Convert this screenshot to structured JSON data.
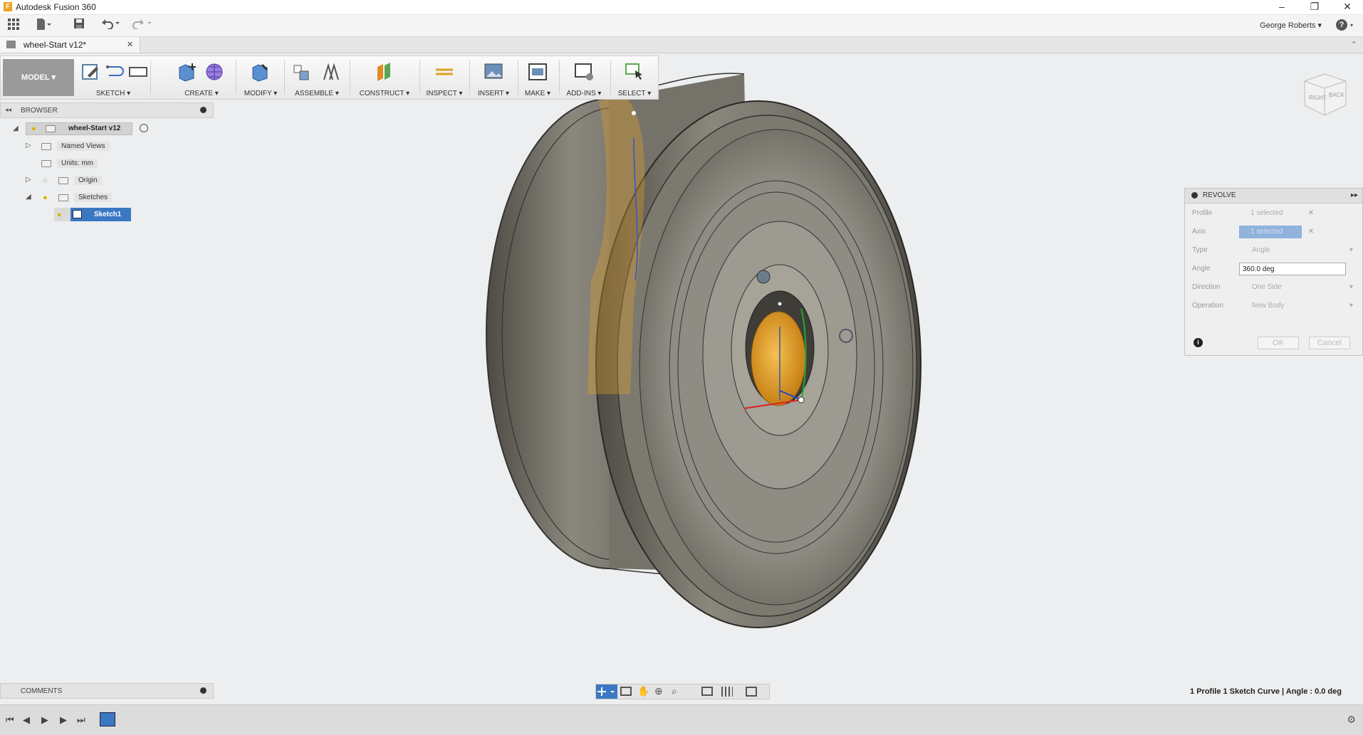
{
  "window": {
    "title": "Autodesk Fusion 360",
    "min": "–",
    "restore": "❐",
    "close": "✕"
  },
  "appbar": {
    "user": "George Roberts ▾",
    "help": "?"
  },
  "document_tab": {
    "name": "wheel-Start v12*",
    "close": "✕"
  },
  "toolbar": {
    "workspace": "MODEL ▾",
    "groups": [
      {
        "label": "SKETCH ▾"
      },
      {
        "label": "CREATE ▾"
      },
      {
        "label": "MODIFY ▾"
      },
      {
        "label": "ASSEMBLE ▾"
      },
      {
        "label": "CONSTRUCT ▾"
      },
      {
        "label": "INSPECT ▾"
      },
      {
        "label": "INSERT ▾"
      },
      {
        "label": "MAKE ▾"
      },
      {
        "label": "ADD-INS ▾"
      },
      {
        "label": "SELECT ▾"
      }
    ]
  },
  "browser": {
    "title": "BROWSER",
    "items": [
      {
        "label": "wheel-Start v12"
      },
      {
        "label": "Named Views"
      },
      {
        "label": "Units: mm"
      },
      {
        "label": "Origin"
      },
      {
        "label": "Sketches"
      },
      {
        "label": "Sketch1"
      }
    ]
  },
  "comments": {
    "title": "COMMENTS"
  },
  "revolve": {
    "title": "REVOLVE",
    "rows": [
      {
        "label": "Profile",
        "value": "1 selected"
      },
      {
        "label": "Axis",
        "value": "1 selected"
      },
      {
        "label": "Type",
        "value": "Angle"
      },
      {
        "label": "Angle",
        "value": "360.0 deg"
      },
      {
        "label": "Direction",
        "value": "One Side"
      },
      {
        "label": "Operation",
        "value": "New Body"
      }
    ],
    "ok": "OK",
    "cancel": "Cancel"
  },
  "viewcube": {
    "right": "RIGHT",
    "back": "BACK"
  },
  "status": {
    "text": "1 Profile 1 Sketch Curve | Angle : 0.0 deg"
  },
  "colors": {
    "selection": "#3a78c3",
    "wheel": "#6f6c64",
    "sketch_profile": "#e8a426"
  }
}
